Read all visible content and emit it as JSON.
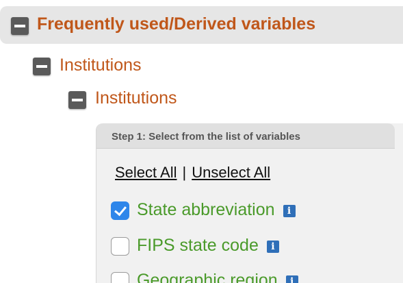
{
  "section": {
    "title": "Frequently used/Derived variables"
  },
  "tree": {
    "level1_label": "Institutions",
    "level2_label": "Institutions"
  },
  "step": {
    "title": "Step 1: Select from the list of variables"
  },
  "selection": {
    "select_all": "Select All",
    "separator": "|",
    "unselect_all": "Unselect All"
  },
  "variables": [
    {
      "label": "State abbreviation",
      "checked": true,
      "info_icon": "i"
    },
    {
      "label": "FIPS state code",
      "checked": false,
      "info_icon": "i"
    },
    {
      "label": "Geographic region",
      "checked": false,
      "info_icon": "i"
    }
  ],
  "colors": {
    "heading_orange": "#c0571a",
    "variable_green": "#4a9a2a",
    "checkbox_blue": "#2e86ea",
    "info_blue": "#2f6fb8"
  }
}
